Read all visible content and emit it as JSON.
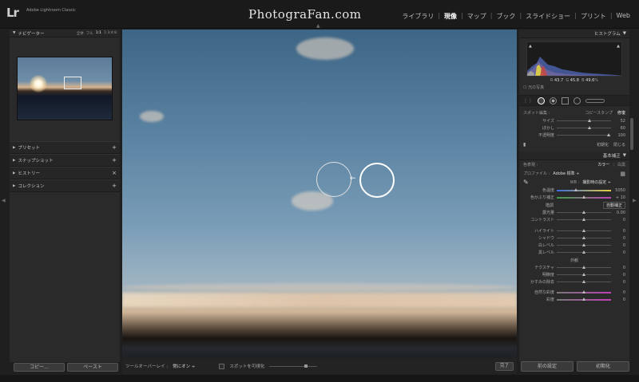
{
  "app": {
    "logo": "Lr",
    "title": "Adobe Lightroom Classic",
    "brand": "PhotograFan.com",
    "modules": [
      {
        "label": "ライブラリ",
        "active": false
      },
      {
        "label": "現像",
        "active": true
      },
      {
        "label": "マップ",
        "active": false
      },
      {
        "label": "ブック",
        "active": false
      },
      {
        "label": "スライドショー",
        "active": false
      },
      {
        "label": "プリント",
        "active": false
      },
      {
        "label": "Web",
        "active": false
      }
    ]
  },
  "left_panel": {
    "navigator": {
      "label": "ナビゲーター",
      "zooms": [
        "全体",
        "フル",
        "1:1",
        "1:3:4:8"
      ]
    },
    "sections": [
      {
        "label": "プリセット",
        "action": "+"
      },
      {
        "label": "スナップショット",
        "action": "+"
      },
      {
        "label": "ヒストリー",
        "action": "×"
      },
      {
        "label": "コレクション",
        "action": "+"
      }
    ],
    "copy_label": "コピー...",
    "paste_label": "ペースト"
  },
  "toolbar": {
    "overlay_label": "ツールオーバーレイ :",
    "overlay_value": "常にオン ÷",
    "visualize_label": "スポットを可視化",
    "done_label": "完了"
  },
  "right_panel": {
    "histogram_label": "ヒストグラム",
    "readout": {
      "r_label": "R",
      "r": "43.7",
      "g_label": "G",
      "g": "45.8",
      "b_label": "B",
      "b": "49.6",
      "unit": "%"
    },
    "original_photo": "元の写真",
    "spot": {
      "label": "スポット編集 :",
      "mode_clone": "コピースタンプ",
      "mode_heal": "修復",
      "sliders": [
        {
          "label": "サイズ",
          "value": "52",
          "pos": 0.6
        },
        {
          "label": "ぼかし",
          "value": "60",
          "pos": 0.6
        },
        {
          "label": "不透明度",
          "value": "100",
          "pos": 0.96
        }
      ],
      "reset_label": "初期化",
      "close_label": "閉じる"
    },
    "basic": {
      "label": "基本補正",
      "treatment_label": "色表現 :",
      "treatment_color": "カラー",
      "treatment_bw": "白黒",
      "profile_label": "プロファイル :",
      "profile_value": "Adobe 標準 ÷",
      "wb_label": "WB :",
      "wb_value": "撮影時の設定 ÷",
      "wb_sliders": [
        {
          "label": "色温度",
          "value": "5050",
          "pos": 0.35
        },
        {
          "label": "色かぶり補正",
          "value": "+ 10",
          "pos": 0.5
        }
      ],
      "tone_label": "階調",
      "auto_label": "自動補正",
      "tone_sliders": [
        {
          "label": "露光量",
          "value": "0.00",
          "pos": 0.5
        },
        {
          "label": "コントラスト",
          "value": "0",
          "pos": 0.5
        },
        {
          "label": "ハイライト",
          "value": "0",
          "pos": 0.5
        },
        {
          "label": "シャドウ",
          "value": "0",
          "pos": 0.5
        },
        {
          "label": "白レベル",
          "value": "0",
          "pos": 0.5
        },
        {
          "label": "黒レベル",
          "value": "0",
          "pos": 0.5
        }
      ],
      "presence_label": "外観",
      "presence_sliders": [
        {
          "label": "テクスチャ",
          "value": "0",
          "pos": 0.5
        },
        {
          "label": "明瞭度",
          "value": "0",
          "pos": 0.5
        },
        {
          "label": "かすみの除去",
          "value": "0",
          "pos": 0.5
        },
        {
          "label": "自然な彩度",
          "value": "0",
          "pos": 0.5
        },
        {
          "label": "彩度",
          "value": "0",
          "pos": 0.5
        }
      ]
    },
    "prev_label": "前の設定",
    "reset_label": "初期化"
  }
}
